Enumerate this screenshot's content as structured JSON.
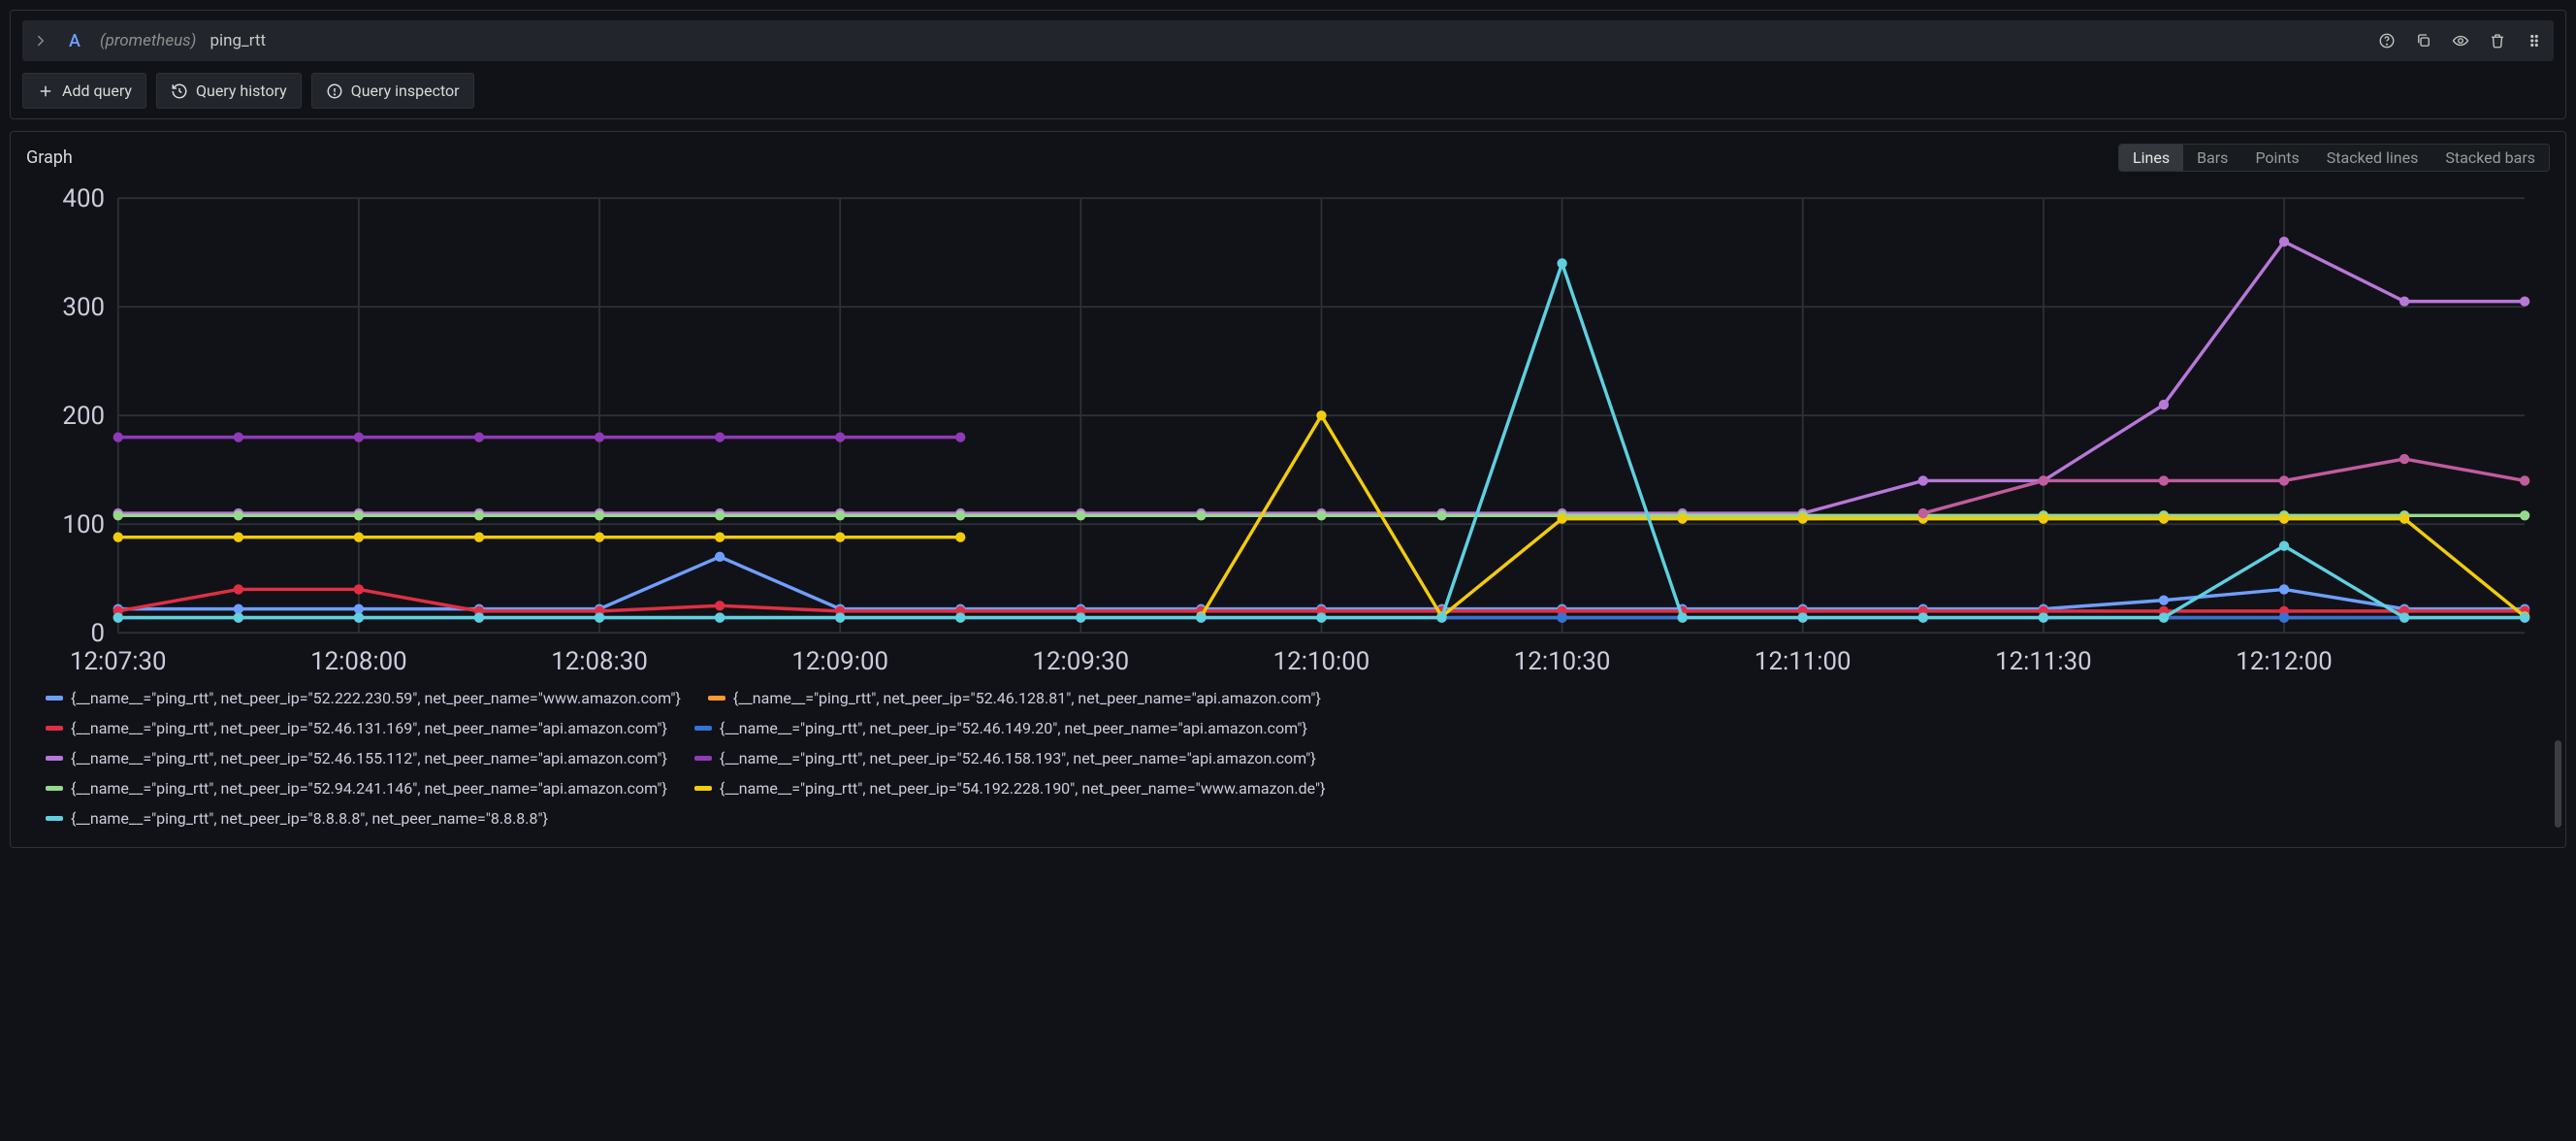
{
  "query_row": {
    "letter": "A",
    "datasource": "(prometheus)",
    "metric": "ping_rtt"
  },
  "toolbar": {
    "add_query": "Add query",
    "query_history": "Query history",
    "query_inspector": "Query inspector"
  },
  "graph": {
    "title": "Graph",
    "viz_options": [
      "Lines",
      "Bars",
      "Points",
      "Stacked lines",
      "Stacked bars"
    ],
    "viz_active": "Lines"
  },
  "chart_data": {
    "type": "line",
    "ylim": [
      0,
      400
    ],
    "y_ticks": [
      0,
      100,
      200,
      300,
      400
    ],
    "x_ticks": [
      "12:07:30",
      "12:08:00",
      "12:08:30",
      "12:09:00",
      "12:09:30",
      "12:10:00",
      "12:10:30",
      "12:11:00",
      "12:11:30",
      "12:12:00"
    ],
    "x_count": 21,
    "series": [
      {
        "name": "{__name__=\"ping_rtt\", net_peer_ip=\"52.222.230.59\", net_peer_name=\"www.amazon.com\"}",
        "color": "#6e9fff",
        "values": [
          22,
          22,
          22,
          22,
          22,
          70,
          22,
          22,
          22,
          22,
          22,
          22,
          22,
          22,
          22,
          22,
          22,
          30,
          40,
          22,
          22
        ]
      },
      {
        "name": "{__name__=\"ping_rtt\", net_peer_ip=\"52.46.128.81\", net_peer_name=\"api.amazon.com\"}",
        "color": "#ff9830",
        "values": [
          14,
          14,
          14,
          14,
          14,
          14,
          14,
          14,
          14,
          14,
          14,
          14,
          14,
          14,
          14,
          14,
          14,
          14,
          14,
          14,
          14
        ]
      },
      {
        "name": "{__name__=\"ping_rtt\", net_peer_ip=\"52.46.131.169\", net_peer_name=\"api.amazon.com\"}",
        "color": "#e02f44",
        "values": [
          20,
          40,
          40,
          20,
          20,
          25,
          20,
          20,
          20,
          20,
          20,
          20,
          20,
          20,
          20,
          20,
          20,
          20,
          20,
          20,
          20
        ]
      },
      {
        "name": "{__name__=\"ping_rtt\", net_peer_ip=\"52.46.149.20\", net_peer_name=\"api.amazon.com\"}",
        "color": "#3274d9",
        "values": [
          14,
          14,
          14,
          14,
          14,
          14,
          14,
          14,
          14,
          14,
          14,
          14,
          14,
          14,
          14,
          14,
          14,
          14,
          14,
          14,
          14
        ]
      },
      {
        "name": "{__name__=\"ping_rtt\", net_peer_ip=\"52.46.155.112\", net_peer_name=\"api.amazon.com\"}",
        "color": "#b877d9",
        "values": [
          110,
          110,
          110,
          110,
          110,
          110,
          110,
          110,
          110,
          110,
          110,
          110,
          110,
          110,
          110,
          140,
          140,
          210,
          360,
          305,
          305
        ]
      },
      {
        "name": "{__name__=\"ping_rtt\", net_peer_ip=\"52.46.158.193\", net_peer_name=\"api.amazon.com\"}",
        "color": "#8f3bb8",
        "values": [
          180,
          180,
          180,
          180,
          180,
          180,
          180,
          180,
          null,
          null,
          null,
          null,
          null,
          null,
          null,
          null,
          null,
          null,
          null,
          null,
          null
        ]
      },
      {
        "name": "{__name__=\"ping_rtt\", net_peer_ip=\"52.94.241.146\", net_peer_name=\"api.amazon.com\"}",
        "color": "#96d98d",
        "values": [
          108,
          108,
          108,
          108,
          108,
          108,
          108,
          108,
          108,
          108,
          108,
          108,
          108,
          108,
          108,
          108,
          108,
          108,
          108,
          108,
          108
        ]
      },
      {
        "name": "{__name__=\"ping_rtt\", net_peer_ip=\"54.192.228.190\", net_peer_name=\"www.amazon.de\"}",
        "color": "#f2cc0c",
        "values": [
          88,
          88,
          88,
          88,
          88,
          88,
          88,
          88,
          null,
          15,
          200,
          15,
          105,
          105,
          105,
          105,
          105,
          105,
          105,
          105,
          15
        ]
      },
      {
        "name": "{__name__=\"ping_rtt\", net_peer_ip=\"8.8.8.8\", net_peer_name=\"8.8.8.8\"}",
        "color": "#5ed0e0",
        "values": [
          14,
          14,
          14,
          14,
          14,
          14,
          14,
          14,
          14,
          14,
          14,
          14,
          340,
          14,
          14,
          14,
          14,
          14,
          80,
          14,
          14
        ]
      },
      {
        "name": "{__name__=\"ping_rtt\", net_peer_ip=\"52.46.128.81\", net_peer_name=\"api.amazon.com\"}",
        "color": "#c15c9e",
        "values": [
          null,
          null,
          null,
          null,
          null,
          null,
          null,
          null,
          null,
          null,
          null,
          null,
          null,
          null,
          null,
          110,
          140,
          140,
          140,
          160,
          140
        ]
      }
    ]
  },
  "legend_rows": [
    [
      0,
      1
    ],
    [
      2,
      3
    ],
    [
      4,
      5
    ],
    [
      6,
      7
    ],
    [
      8
    ]
  ]
}
